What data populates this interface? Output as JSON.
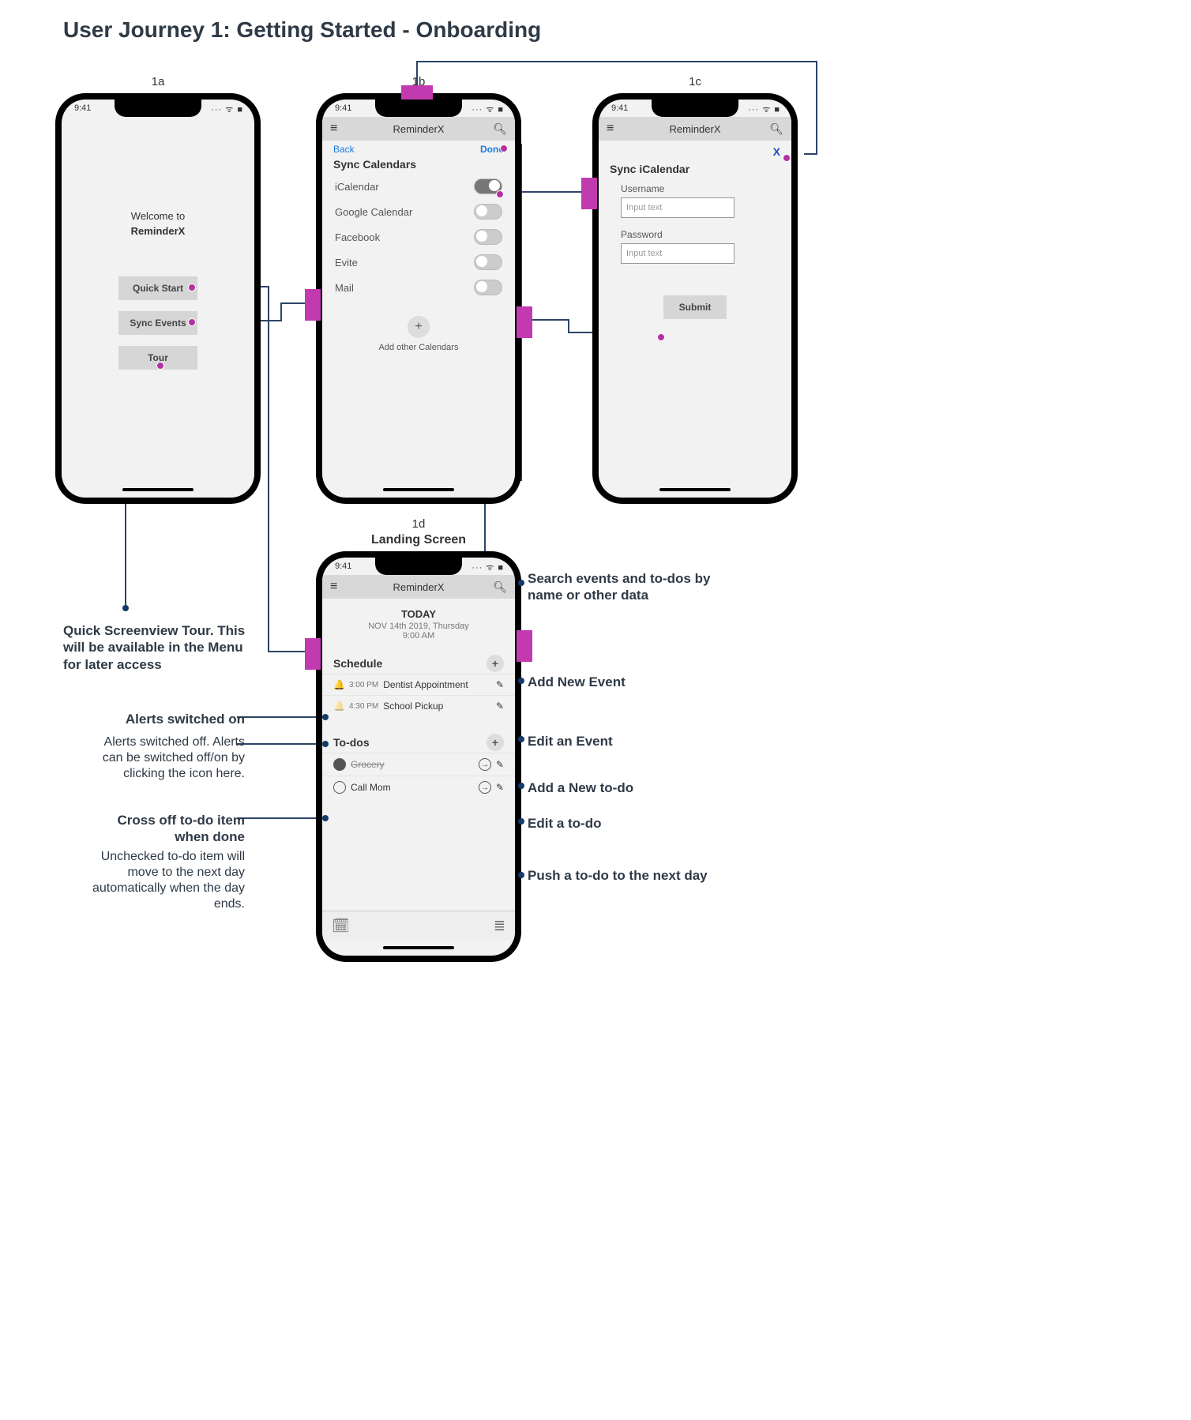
{
  "journey_title": "User Journey 1: Getting Started - Onboarding",
  "labels": {
    "a": "1a",
    "b": "1b",
    "c": "1c",
    "d": "1d",
    "d_sub": "Landing Screen"
  },
  "status": {
    "time": "9:41",
    "icons": "··· ᯤ ■"
  },
  "app_title": "ReminderX",
  "screen_a": {
    "welcome_line": "Welcome to",
    "app": "ReminderX",
    "btn_quick": "Quick Start",
    "btn_sync": "Sync Events",
    "btn_tour": "Tour"
  },
  "screen_b": {
    "back": "Back",
    "done": "Done",
    "title": "Sync Calendars",
    "opts": [
      "iCalendar",
      "Google Calendar",
      "Facebook",
      "Evite",
      "Mail"
    ],
    "add_other": "Add other Calendars"
  },
  "screen_c": {
    "close": "X",
    "title": "Sync iCalendar",
    "user_label": "Username",
    "pass_label": "Password",
    "placeholder": "Input text",
    "submit": "Submit"
  },
  "screen_d": {
    "today": "TODAY",
    "date": "NOV 14th 2019, Thursday",
    "time": "9:00 AM",
    "schedule": "Schedule",
    "todos": "To-dos",
    "events": [
      {
        "time": "3:00 PM",
        "title": "Dentist Appointment",
        "alert": true
      },
      {
        "time": "4:30 PM",
        "title": "School Pickup",
        "alert": false
      }
    ],
    "todo_items": [
      {
        "title": "Grocery",
        "done": true
      },
      {
        "title": "Call Mom",
        "done": false
      }
    ]
  },
  "annotations": {
    "tour": "Quick Screenview Tour. This will be available in the Menu for later access",
    "alert_on": "Alerts switched on",
    "alert_off": "Alerts switched off. Alerts can be switched off/on by clicking the icon here.",
    "cross": "Cross off to-do item when done",
    "unchecked": "Unchecked to-do item will move to the next day automatically when the day ends.",
    "search": "Search events and to-dos by name or other data",
    "add_event": "Add New Event",
    "edit_event": "Edit an Event",
    "add_todo": "Add a New to-do",
    "edit_todo": "Edit a to-do",
    "push_todo": "Push a to-do to the next day"
  }
}
